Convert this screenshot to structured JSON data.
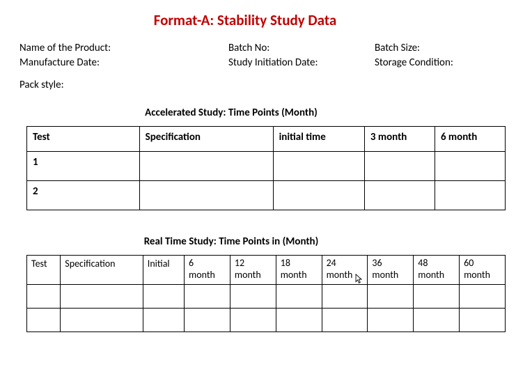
{
  "title": "Format-A: Stability Study Data",
  "meta": {
    "product_label": "Name of the Product:",
    "batch_no_label": "Batch No:",
    "batch_size_label": "Batch Size:",
    "mfg_date_label": "Manufacture Date:",
    "study_init_label": "Study Initiation Date:",
    "storage_label": "Storage Condition:",
    "pack_label": "Pack style:"
  },
  "accel": {
    "section_title": "Accelerated Study: Time Points (Month)",
    "headers": {
      "test": "Test",
      "spec": "Specification",
      "initial": "initial time",
      "m3": "3 month",
      "m6": "6 month"
    },
    "rows": [
      {
        "test": "1",
        "spec": "",
        "initial": "",
        "m3": "",
        "m6": ""
      },
      {
        "test": "2",
        "spec": "",
        "initial": "",
        "m3": "",
        "m6": ""
      }
    ]
  },
  "realtime": {
    "section_title": "Real Time Study: Time Points in (Month)",
    "headers": {
      "test": "Test",
      "spec": "Specification",
      "initial": "Initial",
      "m6_a": "6",
      "m6_b": "month",
      "m12_a": "12",
      "m12_b": "month",
      "m18_a": "18",
      "m18_b": "month",
      "m24_a": "24",
      "m24_b": "month",
      "m36_a": "36",
      "m36_b": "month",
      "m48_a": "48",
      "m48_b": "month",
      "m60_a": "60",
      "m60_b": "month"
    },
    "rows": [
      {
        "test": "",
        "spec": "",
        "initial": "",
        "m6": "",
        "m12": "",
        "m18": "",
        "m24": "",
        "m36": "",
        "m48": "",
        "m60": ""
      },
      {
        "test": "",
        "spec": "",
        "initial": "",
        "m6": "",
        "m12": "",
        "m18": "",
        "m24": "",
        "m36": "",
        "m48": "",
        "m60": ""
      }
    ]
  },
  "chart_data": [
    {
      "type": "table",
      "title": "Accelerated Study: Time Points (Month)",
      "columns": [
        "Test",
        "Specification",
        "initial time",
        "3 month",
        "6 month"
      ],
      "rows": [
        [
          "1",
          "",
          "",
          "",
          ""
        ],
        [
          "2",
          "",
          "",
          "",
          ""
        ]
      ]
    },
    {
      "type": "table",
      "title": "Real Time Study: Time Points in (Month)",
      "columns": [
        "Test",
        "Specification",
        "Initial",
        "6 month",
        "12 month",
        "18 month",
        "24 month",
        "36 month",
        "48 month",
        "60 month"
      ],
      "rows": [
        [
          "",
          "",
          "",
          "",
          "",
          "",
          "",
          "",
          "",
          ""
        ],
        [
          "",
          "",
          "",
          "",
          "",
          "",
          "",
          "",
          "",
          ""
        ]
      ]
    }
  ]
}
